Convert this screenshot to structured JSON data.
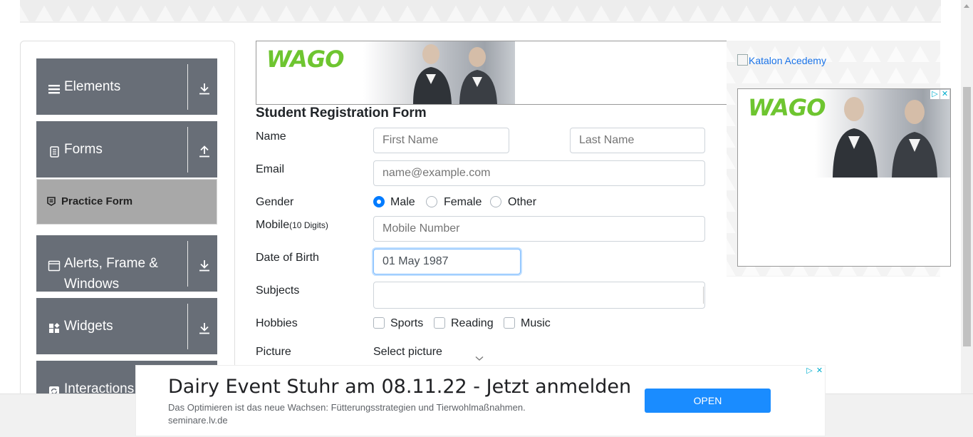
{
  "sidebar": {
    "groups": [
      {
        "label": "Elements",
        "icon": "list-icon",
        "state": "collapsed"
      },
      {
        "label": "Forms",
        "icon": "document-icon",
        "state": "expanded"
      },
      {
        "label": "Alerts, Frame &",
        "label2": "Windows",
        "icon": "window-icon",
        "state": "collapsed"
      },
      {
        "label": "Widgets",
        "icon": "widgets-icon",
        "state": "collapsed"
      },
      {
        "label": "Interactions",
        "icon": "refresh-icon",
        "state": "collapsed"
      }
    ],
    "active_item": {
      "label": "Practice Form",
      "icon": "form-icon"
    }
  },
  "form": {
    "title": "Student Registration Form",
    "name_label": "Name",
    "first_name_placeholder": "First Name",
    "last_name_placeholder": "Last Name",
    "email_label": "Email",
    "email_placeholder": "name@example.com",
    "gender_label": "Gender",
    "gender_options": [
      "Male",
      "Female",
      "Other"
    ],
    "gender_selected": "Male",
    "mobile_label": "Mobile",
    "mobile_hint": "(10 Digits)",
    "mobile_placeholder": "Mobile Number",
    "dob_label": "Date of Birth",
    "dob_value": "01 May 1987",
    "subjects_label": "Subjects",
    "hobbies_label": "Hobbies",
    "hobby_options": [
      "Sports",
      "Reading",
      "Music"
    ],
    "picture_label": "Picture",
    "picture_button": "Select picture"
  },
  "ads": {
    "brand": "WAGO",
    "right_image_alt": "Katalon Acedemy",
    "bottom": {
      "headline": "Dairy Event Stuhr am 08.11.22 - Jetzt anmelden",
      "description": "Das Optimieren ist das neue Wachsen: Fütterungsstrategien und Tierwohlmaßnahmen.",
      "url": "seminare.lv.de",
      "cta": "OPEN"
    }
  },
  "colors": {
    "sidebar_group": "#686e77",
    "active_item": "#a8a8a8",
    "accent": "#007bff",
    "wago_green": "#6ec530",
    "cta_blue": "#1a8cff"
  }
}
